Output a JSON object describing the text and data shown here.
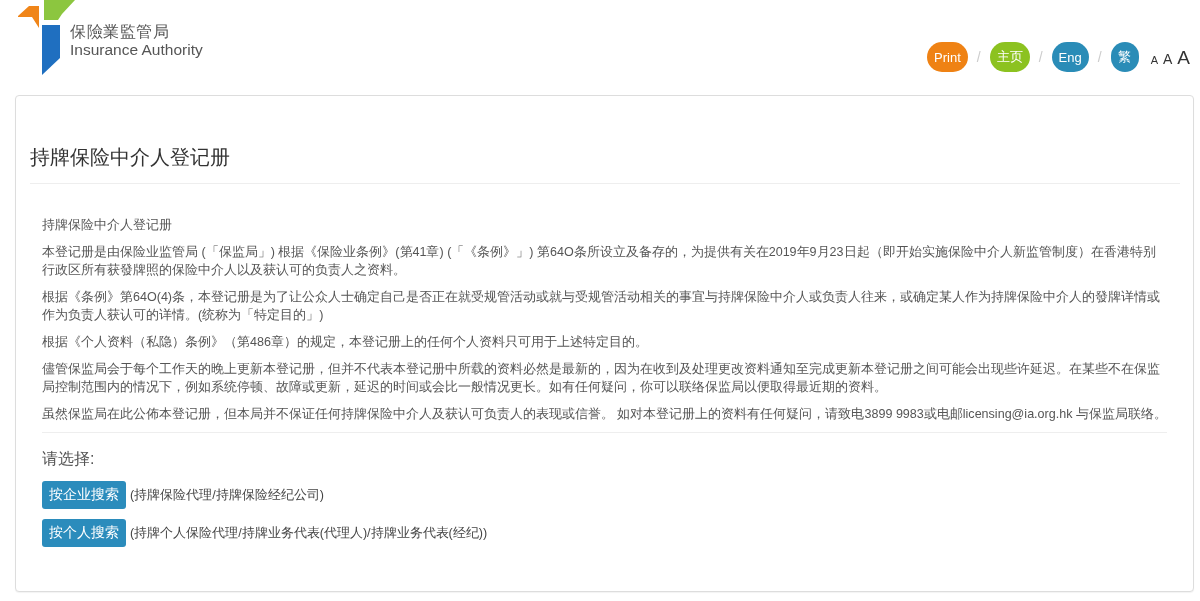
{
  "header": {
    "logo": {
      "name_zh": "保險業監管局",
      "name_en": "Insurance Authority"
    },
    "tools": [
      {
        "label": "Print",
        "color": "#ef8214"
      },
      {
        "separator": "/",
        "label": "主页",
        "color": "#8cc220"
      },
      {
        "separator": "/",
        "label": "Eng",
        "color": "#2a8cb7"
      },
      {
        "separator": "/",
        "label": "繁",
        "color": "#2a8cb7"
      }
    ],
    "font_sizes": [
      {
        "label": "A",
        "kind": "small"
      },
      {
        "label": "A",
        "kind": "medium"
      },
      {
        "label": "A",
        "kind": "large"
      }
    ]
  },
  "panel": {
    "title": "持牌保险中介人登记册",
    "paragraphs": [
      "持牌保险中介人登记册",
      "本登记册是由保险业监管局 (「保监局」) 根据《保险业条例》(第41章) (「《条例》」) 第64O条所设立及备存的，为提供有关在2019年9月23日起（即开始实施保险中介人新监管制度）在香港特别行政区所有获發牌照的保险中介人以及获认可的负责人之资料。",
      "根据《条例》第64O(4)条，本登记册是为了让公众人士确定自己是否正在就受规管活动或就与受规管活动相关的事宜与持牌保险中介人或负责人往来，或确定某人作为持牌保险中介人的發牌详情或作为负责人获认可的详情。(统称为「特定目的」)",
      "根据《个人资料（私隐）条例》（第486章）的规定，本登记册上的任何个人资料只可用于上述特定目的。",
      "儘管保监局会于每个工作天的晚上更新本登记册，但并不代表本登记册中所载的资料必然是最新的，因为在收到及处理更改资料通知至完成更新本登记册之间可能会出现些许延迟。在某些不在保监局控制范围内的情况下，例如系统停顿、故障或更新，延迟的时间或会比一般情况更长。如有任何疑问，你可以联络保监局以便取得最近期的资料。",
      "虽然保监局在此公佈本登记册，但本局并不保证任何持牌保险中介人及获认可负责人的表现或信誉。 如对本登记册上的资料有任何疑问，请致电3899 9983或电邮licensing@ia.org.hk 与保监局联络。"
    ],
    "prompt": "请选择:",
    "searches": [
      {
        "button": "按企业搜索",
        "description": "(持牌保险代理/持牌保险经纪公司)"
      },
      {
        "button": "按个人搜索",
        "description": "(持牌个人保险代理/持牌业务代表(代理人)/持牌业务代表(经纪))"
      }
    ]
  }
}
